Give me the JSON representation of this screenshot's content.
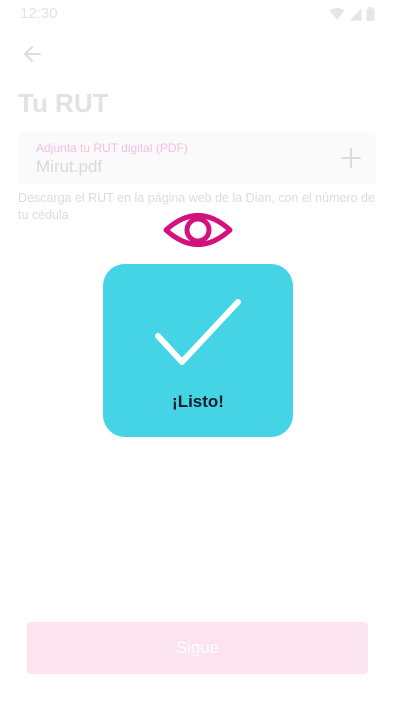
{
  "status_bar": {
    "time": "12:30",
    "icons": [
      "wifi-icon",
      "signal-icon",
      "battery-icon"
    ]
  },
  "header": {
    "back_icon": "arrow-left-icon",
    "title": "Tu RUT"
  },
  "file_field": {
    "label": "Adjunta tu RUT digital (PDF)",
    "value": "Mirut.pdf",
    "action_icon": "plus-icon"
  },
  "helper_text": "Descarga el RUT en la página web de la Dian, con el número de tu cédula",
  "submit": {
    "label": "Sigue"
  },
  "overlay": {
    "preview_icon": "eye-icon",
    "status_icon": "checkmark-icon",
    "status_label": "¡Listo!"
  },
  "colors": {
    "accent_magenta": "#d3127f",
    "success_card": "#44d4e6",
    "submit_disabled": "#fbe3ef"
  }
}
